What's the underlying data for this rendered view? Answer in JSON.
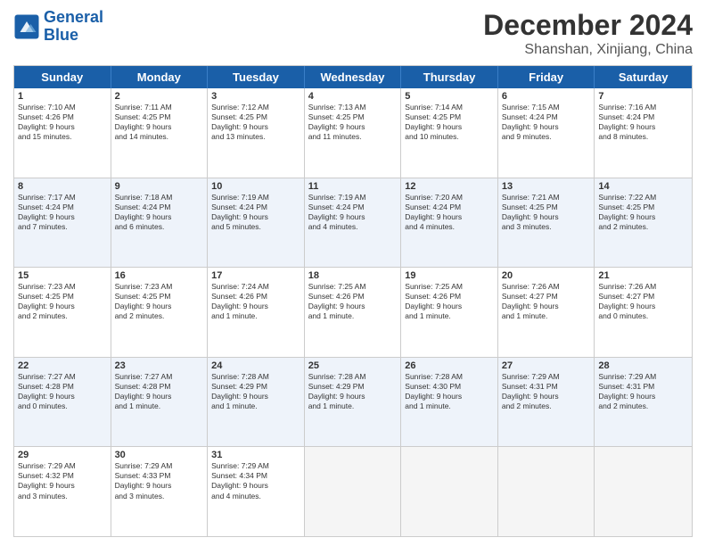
{
  "logo": {
    "line1": "General",
    "line2": "Blue"
  },
  "title": "December 2024",
  "subtitle": "Shanshan, Xinjiang, China",
  "header_days": [
    "Sunday",
    "Monday",
    "Tuesday",
    "Wednesday",
    "Thursday",
    "Friday",
    "Saturday"
  ],
  "rows": [
    [
      {
        "day": "1",
        "info": "Sunrise: 7:10 AM\nSunset: 4:26 PM\nDaylight: 9 hours\nand 15 minutes."
      },
      {
        "day": "2",
        "info": "Sunrise: 7:11 AM\nSunset: 4:25 PM\nDaylight: 9 hours\nand 14 minutes."
      },
      {
        "day": "3",
        "info": "Sunrise: 7:12 AM\nSunset: 4:25 PM\nDaylight: 9 hours\nand 13 minutes."
      },
      {
        "day": "4",
        "info": "Sunrise: 7:13 AM\nSunset: 4:25 PM\nDaylight: 9 hours\nand 11 minutes."
      },
      {
        "day": "5",
        "info": "Sunrise: 7:14 AM\nSunset: 4:25 PM\nDaylight: 9 hours\nand 10 minutes."
      },
      {
        "day": "6",
        "info": "Sunrise: 7:15 AM\nSunset: 4:24 PM\nDaylight: 9 hours\nand 9 minutes."
      },
      {
        "day": "7",
        "info": "Sunrise: 7:16 AM\nSunset: 4:24 PM\nDaylight: 9 hours\nand 8 minutes."
      }
    ],
    [
      {
        "day": "8",
        "info": "Sunrise: 7:17 AM\nSunset: 4:24 PM\nDaylight: 9 hours\nand 7 minutes."
      },
      {
        "day": "9",
        "info": "Sunrise: 7:18 AM\nSunset: 4:24 PM\nDaylight: 9 hours\nand 6 minutes."
      },
      {
        "day": "10",
        "info": "Sunrise: 7:19 AM\nSunset: 4:24 PM\nDaylight: 9 hours\nand 5 minutes."
      },
      {
        "day": "11",
        "info": "Sunrise: 7:19 AM\nSunset: 4:24 PM\nDaylight: 9 hours\nand 4 minutes."
      },
      {
        "day": "12",
        "info": "Sunrise: 7:20 AM\nSunset: 4:24 PM\nDaylight: 9 hours\nand 4 minutes."
      },
      {
        "day": "13",
        "info": "Sunrise: 7:21 AM\nSunset: 4:25 PM\nDaylight: 9 hours\nand 3 minutes."
      },
      {
        "day": "14",
        "info": "Sunrise: 7:22 AM\nSunset: 4:25 PM\nDaylight: 9 hours\nand 2 minutes."
      }
    ],
    [
      {
        "day": "15",
        "info": "Sunrise: 7:23 AM\nSunset: 4:25 PM\nDaylight: 9 hours\nand 2 minutes."
      },
      {
        "day": "16",
        "info": "Sunrise: 7:23 AM\nSunset: 4:25 PM\nDaylight: 9 hours\nand 2 minutes."
      },
      {
        "day": "17",
        "info": "Sunrise: 7:24 AM\nSunset: 4:26 PM\nDaylight: 9 hours\nand 1 minute."
      },
      {
        "day": "18",
        "info": "Sunrise: 7:25 AM\nSunset: 4:26 PM\nDaylight: 9 hours\nand 1 minute."
      },
      {
        "day": "19",
        "info": "Sunrise: 7:25 AM\nSunset: 4:26 PM\nDaylight: 9 hours\nand 1 minute."
      },
      {
        "day": "20",
        "info": "Sunrise: 7:26 AM\nSunset: 4:27 PM\nDaylight: 9 hours\nand 1 minute."
      },
      {
        "day": "21",
        "info": "Sunrise: 7:26 AM\nSunset: 4:27 PM\nDaylight: 9 hours\nand 0 minutes."
      }
    ],
    [
      {
        "day": "22",
        "info": "Sunrise: 7:27 AM\nSunset: 4:28 PM\nDaylight: 9 hours\nand 0 minutes."
      },
      {
        "day": "23",
        "info": "Sunrise: 7:27 AM\nSunset: 4:28 PM\nDaylight: 9 hours\nand 1 minute."
      },
      {
        "day": "24",
        "info": "Sunrise: 7:28 AM\nSunset: 4:29 PM\nDaylight: 9 hours\nand 1 minute."
      },
      {
        "day": "25",
        "info": "Sunrise: 7:28 AM\nSunset: 4:29 PM\nDaylight: 9 hours\nand 1 minute."
      },
      {
        "day": "26",
        "info": "Sunrise: 7:28 AM\nSunset: 4:30 PM\nDaylight: 9 hours\nand 1 minute."
      },
      {
        "day": "27",
        "info": "Sunrise: 7:29 AM\nSunset: 4:31 PM\nDaylight: 9 hours\nand 2 minutes."
      },
      {
        "day": "28",
        "info": "Sunrise: 7:29 AM\nSunset: 4:31 PM\nDaylight: 9 hours\nand 2 minutes."
      }
    ],
    [
      {
        "day": "29",
        "info": "Sunrise: 7:29 AM\nSunset: 4:32 PM\nDaylight: 9 hours\nand 3 minutes."
      },
      {
        "day": "30",
        "info": "Sunrise: 7:29 AM\nSunset: 4:33 PM\nDaylight: 9 hours\nand 3 minutes."
      },
      {
        "day": "31",
        "info": "Sunrise: 7:29 AM\nSunset: 4:34 PM\nDaylight: 9 hours\nand 4 minutes."
      },
      {
        "day": "",
        "info": ""
      },
      {
        "day": "",
        "info": ""
      },
      {
        "day": "",
        "info": ""
      },
      {
        "day": "",
        "info": ""
      }
    ]
  ]
}
